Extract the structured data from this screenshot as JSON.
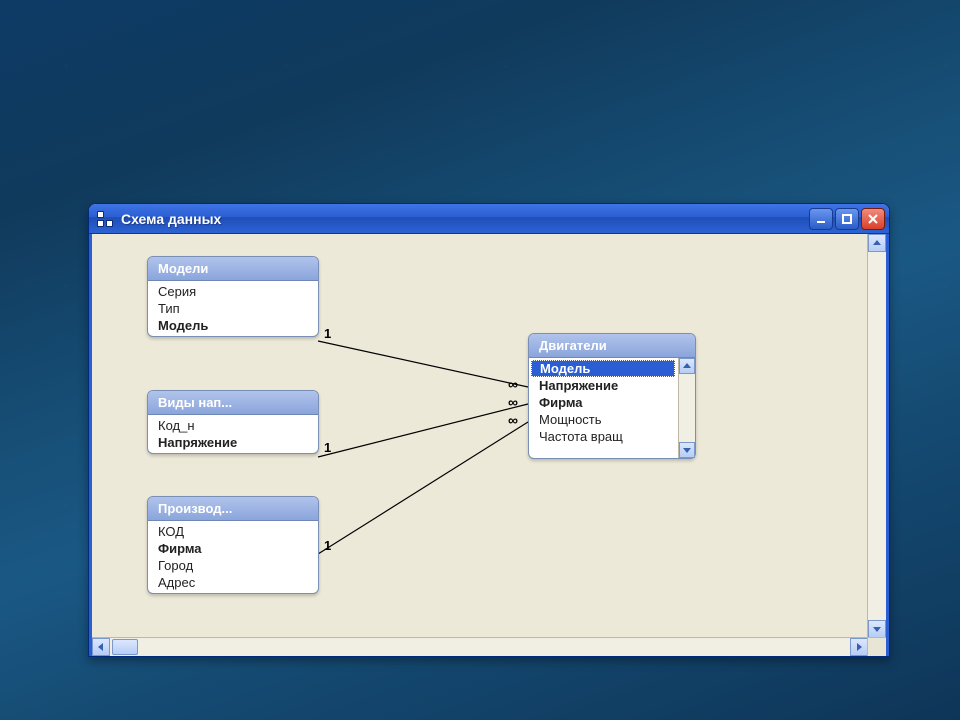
{
  "window": {
    "title": "Схема данных"
  },
  "tables": {
    "models": {
      "title": "Модели",
      "fields": [
        "Серия",
        "Тип",
        "Модель"
      ]
    },
    "voltage_types": {
      "title": "Виды нап...",
      "fields": [
        "Код_н",
        "Напряжение"
      ]
    },
    "producers": {
      "title": "Производ...",
      "fields": [
        "КОД",
        "Фирма",
        "Город",
        "Адрес"
      ]
    },
    "engines": {
      "title": "Двигатели",
      "fields": [
        "Модель",
        "Напряжение",
        "Фирма",
        "Мощность",
        "Частота вращ"
      ]
    }
  },
  "relations": {
    "one": "1",
    "many": "∞"
  }
}
